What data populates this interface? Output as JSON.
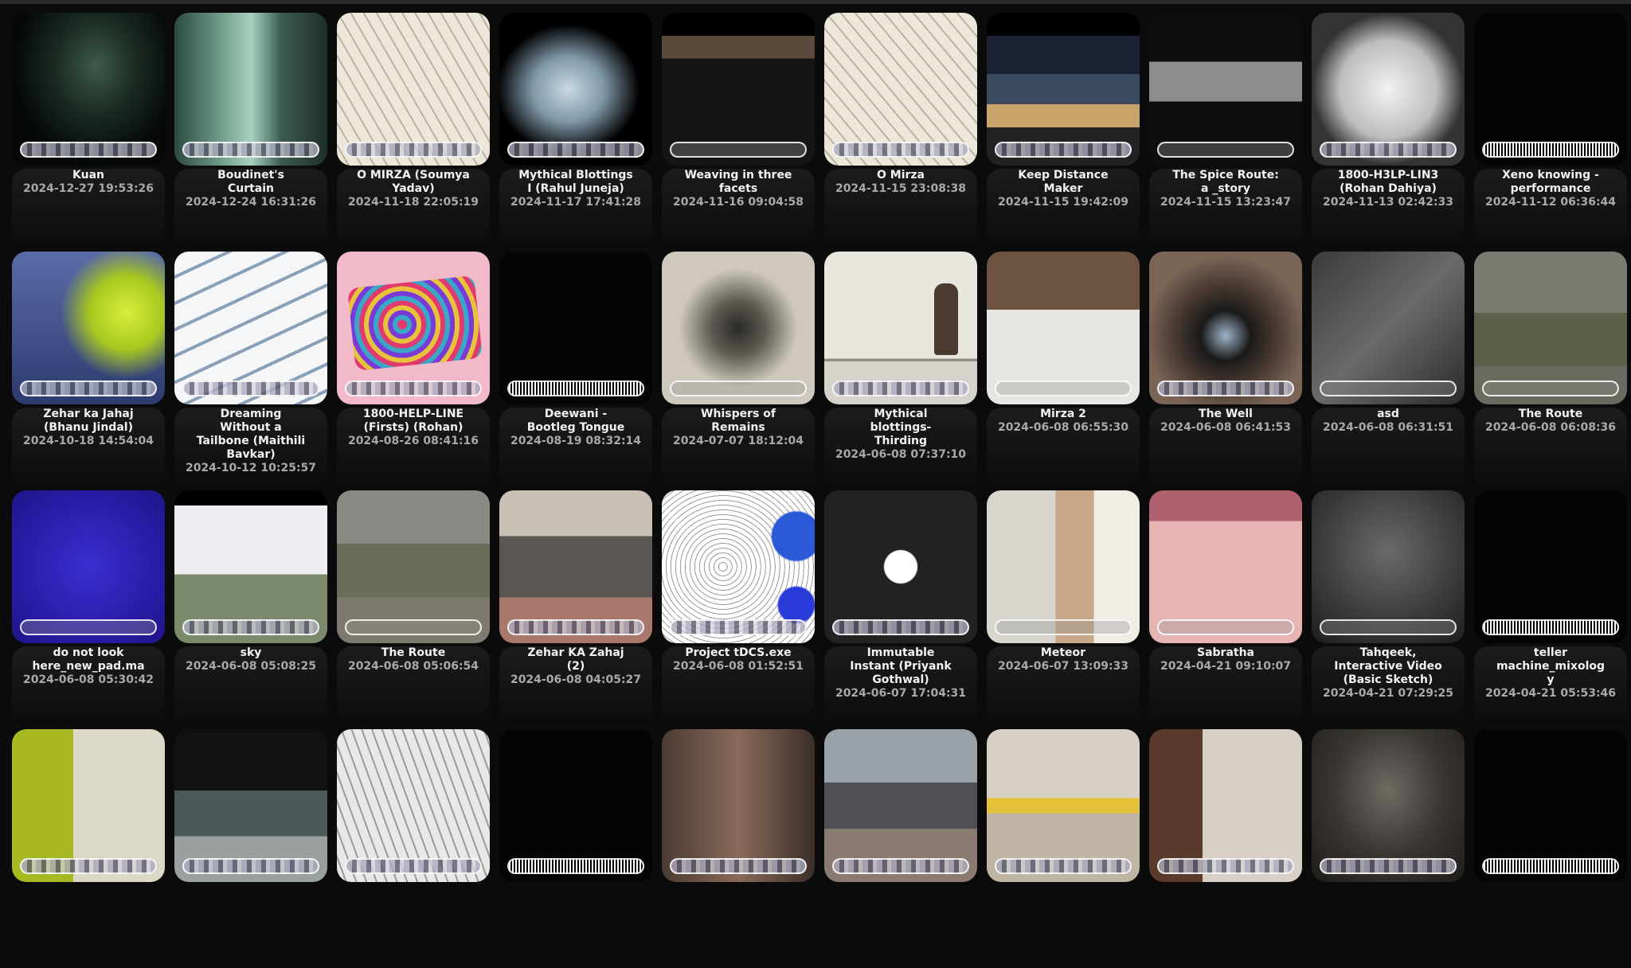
{
  "gallery": {
    "items": [
      {
        "title": "Kuan",
        "date": "2024-12-27 19:53:26",
        "scrubber": "frames"
      },
      {
        "title": "Boudinet's Curtain",
        "date": "2024-12-24 16:31:26",
        "scrubber": "frames"
      },
      {
        "title": "O MIRZA (Soumya Yadav)",
        "date": "2024-11-18 22:05:19",
        "scrubber": "frames"
      },
      {
        "title": "Mythical Blottings I (Rahul Juneja)",
        "date": "2024-11-17 17:41:28",
        "scrubber": "frames"
      },
      {
        "title": "Weaving in three facets",
        "date": "2024-11-16 09:04:58",
        "scrubber": "empty"
      },
      {
        "title": "O Mirza",
        "date": "2024-11-15 23:08:38",
        "scrubber": "frames"
      },
      {
        "title": "Keep Distance Maker",
        "date": "2024-11-15 19:42:09",
        "scrubber": "frames"
      },
      {
        "title": "The Spice Route: a _story",
        "date": "2024-11-15 13:23:47",
        "scrubber": "empty"
      },
      {
        "title": "1800-H3LP-LIN3 (Rohan Dahiya)",
        "date": "2024-11-13 02:42:33",
        "scrubber": "frames"
      },
      {
        "title": "Xeno knowing - performance",
        "date": "2024-11-12 06:36:44",
        "scrubber": "audio"
      },
      {
        "title": "Zehar ka Jahaj (Bhanu Jindal)",
        "date": "2024-10-18 14:54:04",
        "scrubber": "frames"
      },
      {
        "title": "Dreaming Without a Tailbone (Maithili Bavkar)",
        "date": "2024-10-12 10:25:57",
        "scrubber": "frames"
      },
      {
        "title": "1800-HELP-LINE (Firsts) (Rohan)",
        "date": "2024-08-26 08:41:16",
        "scrubber": "frames"
      },
      {
        "title": "Deewani - Bootleg Tongue",
        "date": "2024-08-19 08:32:14",
        "scrubber": "audio"
      },
      {
        "title": "Whispers of Remains",
        "date": "2024-07-07 18:12:04",
        "scrubber": "empty"
      },
      {
        "title": "Mythical blottings- Thirding",
        "date": "2024-06-08 07:37:10",
        "scrubber": "frames"
      },
      {
        "title": "Mirza 2",
        "date": "2024-06-08 06:55:30",
        "scrubber": "empty"
      },
      {
        "title": "The Well",
        "date": "2024-06-08 06:41:53",
        "scrubber": "frames"
      },
      {
        "title": "asd",
        "date": "2024-06-08 06:31:51",
        "scrubber": "empty"
      },
      {
        "title": "The Route",
        "date": "2024-06-08 06:08:36",
        "scrubber": "empty"
      },
      {
        "title": "do not look here_new_pad.ma",
        "date": "2024-06-08 05:30:42",
        "scrubber": "empty"
      },
      {
        "title": "sky",
        "date": "2024-06-08 05:08:25",
        "scrubber": "frames"
      },
      {
        "title": "The Route",
        "date": "2024-06-08 05:06:54",
        "scrubber": "empty"
      },
      {
        "title": "Zehar KA Zahaj (2)",
        "date": "2024-06-08 04:05:27",
        "scrubber": "frames"
      },
      {
        "title": "Project tDCS.exe",
        "date": "2024-06-08 01:52:51",
        "scrubber": "frames"
      },
      {
        "title": "Immutable Instant (Priyank Gothwal)",
        "date": "2024-06-07 17:04:31",
        "scrubber": "frames"
      },
      {
        "title": "Meteor",
        "date": "2024-06-07 13:09:33",
        "scrubber": "empty"
      },
      {
        "title": "Sabratha",
        "date": "2024-04-21 09:10:07",
        "scrubber": "empty"
      },
      {
        "title": "Tahqeek, Interactive Video (Basic Sketch)",
        "date": "2024-04-21 07:29:25",
        "scrubber": "empty"
      },
      {
        "title": "teller machine_mixology",
        "date": "2024-04-21 05:53:46",
        "scrubber": "audio"
      },
      {
        "title": "",
        "date": "",
        "scrubber": "frames"
      },
      {
        "title": "",
        "date": "",
        "scrubber": "frames"
      },
      {
        "title": "",
        "date": "",
        "scrubber": "frames"
      },
      {
        "title": "",
        "date": "",
        "scrubber": "audio"
      },
      {
        "title": "",
        "date": "",
        "scrubber": "frames"
      },
      {
        "title": "",
        "date": "",
        "scrubber": "frames"
      },
      {
        "title": "",
        "date": "",
        "scrubber": "frames"
      },
      {
        "title": "",
        "date": "",
        "scrubber": "frames"
      },
      {
        "title": "",
        "date": "",
        "scrubber": "frames"
      },
      {
        "title": "",
        "date": "",
        "scrubber": "audio"
      }
    ]
  }
}
